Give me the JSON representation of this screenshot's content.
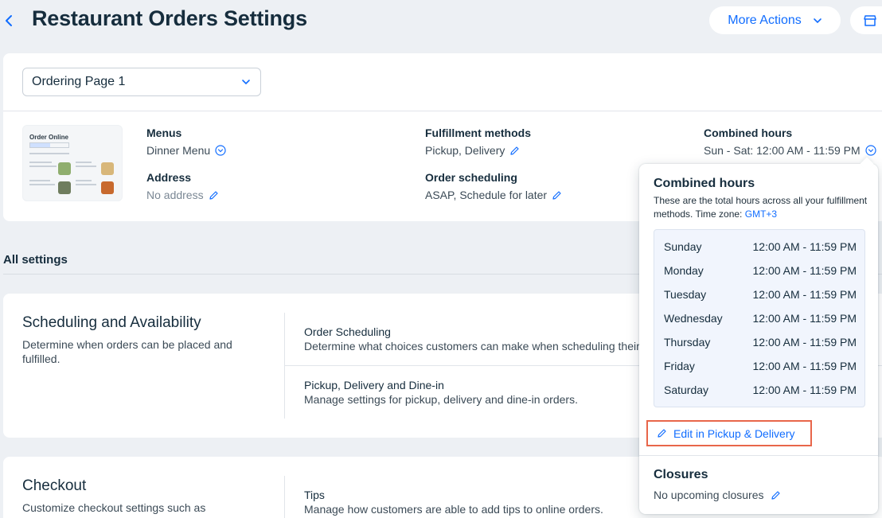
{
  "header": {
    "title": "Restaurant Orders Settings",
    "more_actions_label": "More Actions"
  },
  "top_card": {
    "page_select_value": "Ordering Page 1",
    "thumbnail": {
      "title": "Order Online"
    },
    "menus": {
      "label": "Menus",
      "value": "Dinner Menu"
    },
    "address": {
      "label": "Address",
      "value": "No address"
    },
    "fulfillment": {
      "label": "Fulfillment methods",
      "value": "Pickup, Delivery"
    },
    "scheduling": {
      "label": "Order scheduling",
      "value": "ASAP, Schedule for later"
    },
    "combined": {
      "label": "Combined hours",
      "value": "Sun - Sat: 12:00 AM - 11:59 PM"
    }
  },
  "all_settings_label": "All settings",
  "sections": {
    "scheduling": {
      "title": "Scheduling and Availability",
      "desc": "Determine when orders can be placed and fulfilled.",
      "rows": [
        {
          "title": "Order Scheduling",
          "desc": "Determine what choices customers can make when scheduling their orders."
        },
        {
          "title": "Pickup, Delivery and Dine-in",
          "desc": "Manage settings for pickup, delivery and dine-in orders."
        }
      ]
    },
    "checkout": {
      "title": "Checkout",
      "desc": "Customize checkout settings such as",
      "rows": [
        {
          "title": "Tips",
          "desc": "Manage how customers are able to add tips to online orders."
        }
      ]
    }
  },
  "popover": {
    "title": "Combined hours",
    "desc": "These are the total hours across all your fulfillment methods. Time zone: ",
    "timezone": "GMT+3",
    "hours": [
      {
        "day": "Sunday",
        "time": "12:00 AM - 11:59 PM"
      },
      {
        "day": "Monday",
        "time": "12:00 AM - 11:59 PM"
      },
      {
        "day": "Tuesday",
        "time": "12:00 AM - 11:59 PM"
      },
      {
        "day": "Wednesday",
        "time": "12:00 AM - 11:59 PM"
      },
      {
        "day": "Thursday",
        "time": "12:00 AM - 11:59 PM"
      },
      {
        "day": "Friday",
        "time": "12:00 AM - 11:59 PM"
      },
      {
        "day": "Saturday",
        "time": "12:00 AM - 11:59 PM"
      }
    ],
    "edit_label": "Edit in Pickup & Delivery",
    "closures_title": "Closures",
    "closures_value": "No upcoming closures"
  },
  "colors": {
    "accent": "#116dff",
    "highlight_border": "#e8664a",
    "background": "#edf0f4"
  }
}
